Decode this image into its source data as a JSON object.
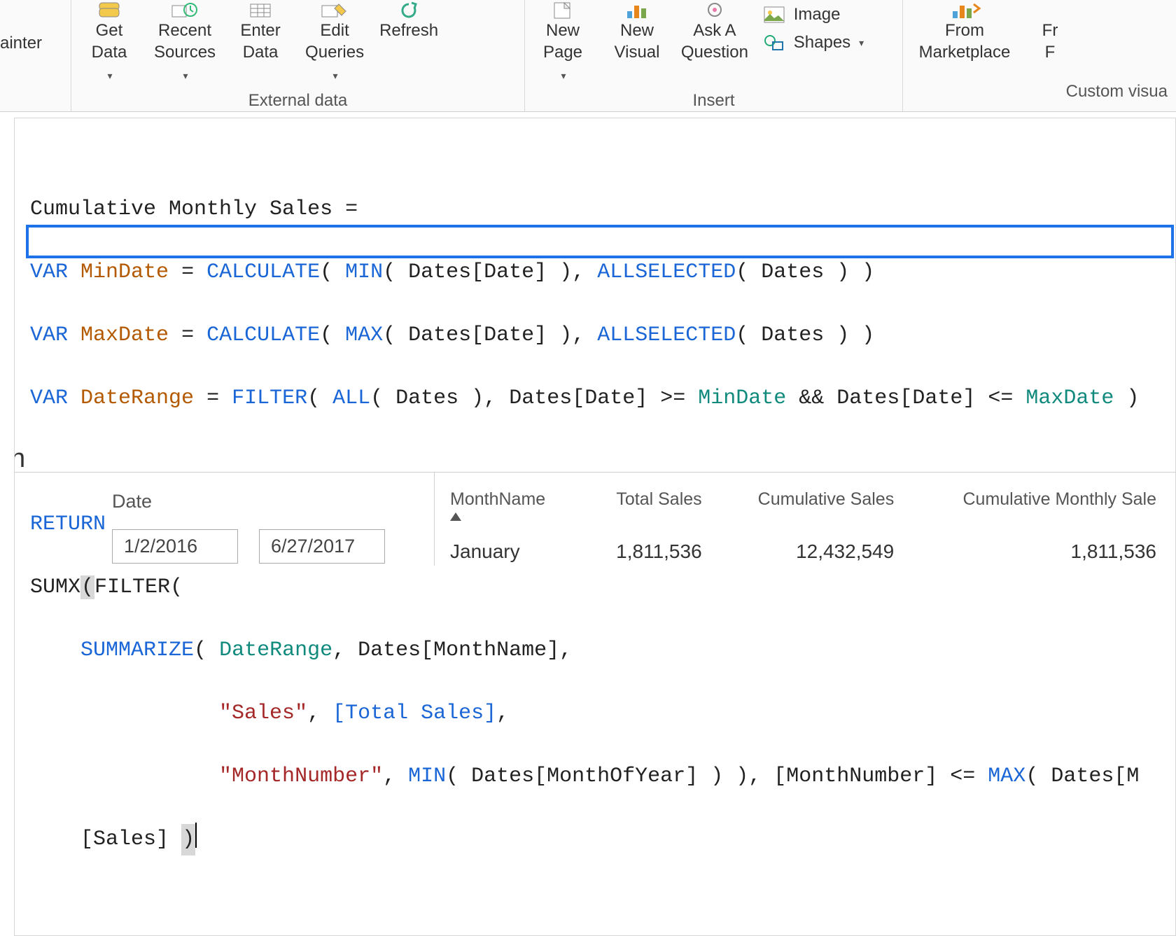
{
  "ribbon": {
    "painter_partial": "ainter",
    "groups": {
      "external_data": {
        "label": "External data",
        "get_data": "Get\nData",
        "recent_sources": "Recent\nSources",
        "enter_data": "Enter\nData",
        "edit_queries": "Edit\nQueries",
        "refresh": "Refresh"
      },
      "insert": {
        "label": "Insert",
        "new_page": "New\nPage",
        "new_visual": "New\nVisual",
        "ask_a_question": "Ask A\nQuestion",
        "image": "Image",
        "shapes": "Shapes"
      },
      "custom_visuals": {
        "label": "Custom visua",
        "from_marketplace": "From\nMarketplace",
        "from_partial": "Fr\nF"
      }
    }
  },
  "formula": {
    "line1_name": "Cumulative Monthly Sales = ",
    "var_kw": "VAR",
    "mindate": "MinDate",
    "maxdate": "MaxDate",
    "daterange": "DateRange",
    "calculate": "CALCULATE",
    "min_fn": "MIN",
    "max_fn": "MAX",
    "allselected": "ALLSELECTED",
    "filter": "FILTER",
    "all": "ALL",
    "return_kw": "RETURN",
    "sumx": "SUMX",
    "summarize": "SUMMARIZE",
    "datescol": "Dates[Date]",
    "datestbl": "Dates",
    "eq": " = ",
    "gte": " >= ",
    "and": " && ",
    "lte": " <= ",
    "monthname_col": "Dates[MonthName]",
    "sales_lit": "\"Sales\"",
    "total_sales": "[Total Sales]",
    "monthnum_lit": "\"MonthNumber\"",
    "monthofyear": "Dates[MonthOfYear]",
    "monthnum_col": "[MonthNumber]",
    "datesm_partial": "Dates[M",
    "sales_col": "[Sales]"
  },
  "slicer": {
    "title": "Date",
    "from": "1/2/2016",
    "to": "6/27/2017"
  },
  "table": {
    "cols": [
      "MonthName",
      "Total Sales",
      "Cumulative Sales",
      "Cumulative Monthly Sale"
    ],
    "rows": [
      {
        "month": "January",
        "total": "1,811,536",
        "cum": "12,432,549",
        "cummon": "1,811,536"
      }
    ]
  },
  "chart_data": {
    "type": "table",
    "columns": [
      "MonthName",
      "Total Sales",
      "Cumulative Sales",
      "Cumulative Monthly Sales"
    ],
    "rows": [
      [
        "January",
        1811536,
        12432549,
        1811536
      ]
    ],
    "date_range": [
      "2016-01-02",
      "2017-06-27"
    ]
  }
}
